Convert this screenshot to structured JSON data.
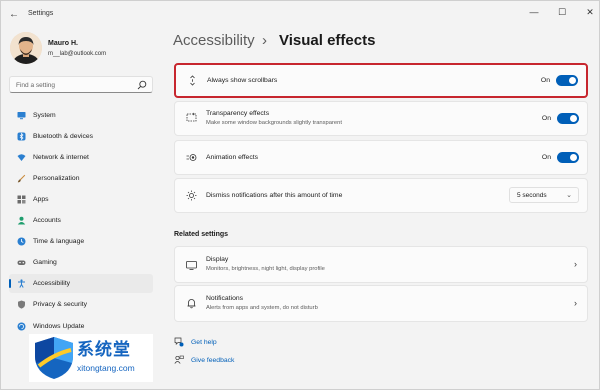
{
  "window": {
    "app_title": "Settings",
    "back_glyph": "←",
    "min_glyph": "—",
    "max_glyph": "☐",
    "close_glyph": "✕"
  },
  "profile": {
    "name": "Mauro H.",
    "email": "m__lab@outlook.com"
  },
  "search": {
    "placeholder": "Find a setting"
  },
  "sidebar": {
    "items": [
      {
        "label": "System",
        "icon": "monitor-icon"
      },
      {
        "label": "Bluetooth & devices",
        "icon": "bluetooth-icon"
      },
      {
        "label": "Network & internet",
        "icon": "wifi-icon"
      },
      {
        "label": "Personalization",
        "icon": "brush-icon"
      },
      {
        "label": "Apps",
        "icon": "apps-icon"
      },
      {
        "label": "Accounts",
        "icon": "person-icon"
      },
      {
        "label": "Time & language",
        "icon": "globe-clock-icon"
      },
      {
        "label": "Gaming",
        "icon": "controller-icon"
      },
      {
        "label": "Accessibility",
        "icon": "accessibility-icon"
      },
      {
        "label": "Privacy & security",
        "icon": "shield-icon"
      },
      {
        "label": "Windows Update",
        "icon": "update-icon"
      }
    ],
    "active_index": 8
  },
  "breadcrumb": {
    "parent": "Accessibility",
    "separator": "›",
    "current": "Visual effects"
  },
  "settings": {
    "scrollbars": {
      "title": "Always show scrollbars",
      "state": "On",
      "on": true
    },
    "transparency": {
      "title": "Transparency effects",
      "subtitle": "Make some window backgrounds slightly transparent",
      "state": "On",
      "on": true
    },
    "animation": {
      "title": "Animation effects",
      "state": "On",
      "on": true
    },
    "notifications": {
      "title": "Dismiss notifications after this amount of time",
      "value": "5 seconds",
      "chevron": "⌄"
    }
  },
  "related": {
    "heading": "Related settings",
    "display": {
      "title": "Display",
      "subtitle": "Monitors, brightness, night light, display profile",
      "chevron": "›"
    },
    "notifications": {
      "title": "Notifications",
      "subtitle": "Alerts from apps and system, do not disturb",
      "chevron": "›"
    }
  },
  "links": {
    "help": "Get help",
    "feedback": "Give feedback"
  },
  "watermark": {
    "text": "系统堂",
    "sub": "xitongtang.com"
  },
  "colors": {
    "accent": "#005fb8",
    "highlight_border": "#c7262e"
  }
}
